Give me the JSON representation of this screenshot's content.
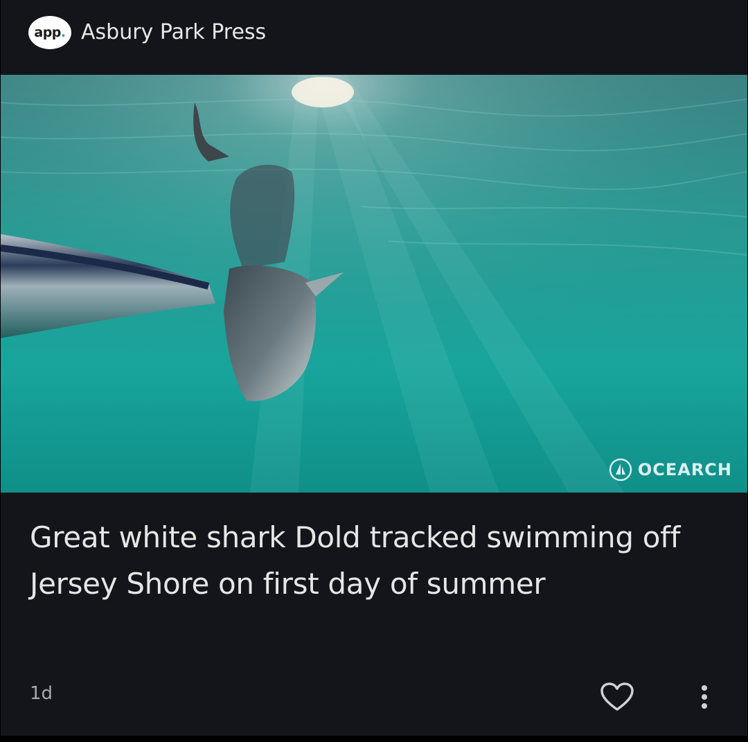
{
  "source": {
    "logo_text": "app",
    "logo_dot": ".",
    "name": "Asbury Park Press"
  },
  "image": {
    "watermark": "OCEARCH",
    "subject": "underwater photo of a great white shark beside a boat",
    "colors": {
      "water_top": "#2e8a86",
      "water_bottom": "#17a09a",
      "shark": "#5d6a70"
    }
  },
  "article": {
    "headline": "Great white shark Dold tracked swimming off Jersey Shore on first day of summer",
    "age": "1d"
  },
  "actions": {
    "like_icon": "heart-outline-icon",
    "more_icon": "vertical-dots-icon"
  },
  "colors": {
    "background": "#14151a",
    "text_primary": "#e6e6e6",
    "text_secondary": "#a9a9ad"
  }
}
